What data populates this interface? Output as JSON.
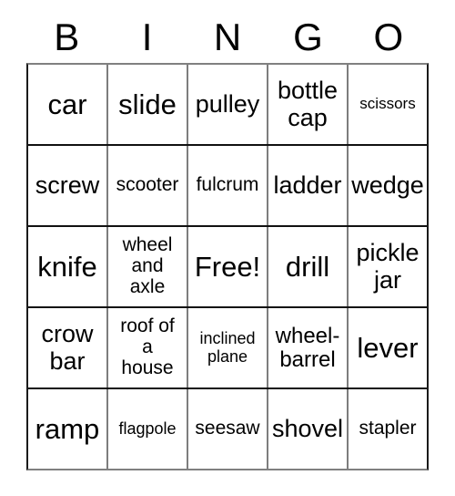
{
  "card": {
    "title_letters": [
      "B",
      "I",
      "N",
      "G",
      "O"
    ],
    "rows": [
      [
        {
          "text": "car",
          "size": "fs-xl"
        },
        {
          "text": "slide",
          "size": "fs-xl"
        },
        {
          "text": "pulley",
          "size": "fs-lg"
        },
        {
          "text": "bottle\ncap",
          "size": "fs-lg"
        },
        {
          "text": "scissors",
          "size": "fs-xxs"
        }
      ],
      [
        {
          "text": "screw",
          "size": "fs-lg"
        },
        {
          "text": "scooter",
          "size": "fs-sm"
        },
        {
          "text": "fulcrum",
          "size": "fs-sm"
        },
        {
          "text": "ladder",
          "size": "fs-lg"
        },
        {
          "text": "wedge",
          "size": "fs-lg"
        }
      ],
      [
        {
          "text": "knife",
          "size": "fs-xl"
        },
        {
          "text": "wheel\nand\naxle",
          "size": "fs-sm"
        },
        {
          "text": "Free!",
          "size": "fs-xl"
        },
        {
          "text": "drill",
          "size": "fs-xl"
        },
        {
          "text": "pickle\njar",
          "size": "fs-lg"
        }
      ],
      [
        {
          "text": "crow\nbar",
          "size": "fs-lg"
        },
        {
          "text": "roof of\na\nhouse",
          "size": "fs-sm"
        },
        {
          "text": "inclined\nplane",
          "size": "fs-xs"
        },
        {
          "text": "wheel-\nbarrel",
          "size": "fs-md"
        },
        {
          "text": "lever",
          "size": "fs-xl"
        }
      ],
      [
        {
          "text": "ramp",
          "size": "fs-xl"
        },
        {
          "text": "flagpole",
          "size": "fs-xs"
        },
        {
          "text": "seesaw",
          "size": "fs-sm"
        },
        {
          "text": "shovel",
          "size": "fs-lg"
        },
        {
          "text": "stapler",
          "size": "fs-sm"
        }
      ]
    ]
  },
  "colors": {
    "text": "#000000",
    "background": "#ffffff",
    "grid_line": "#7d7d7d",
    "grid_line_strong": "#111111"
  }
}
